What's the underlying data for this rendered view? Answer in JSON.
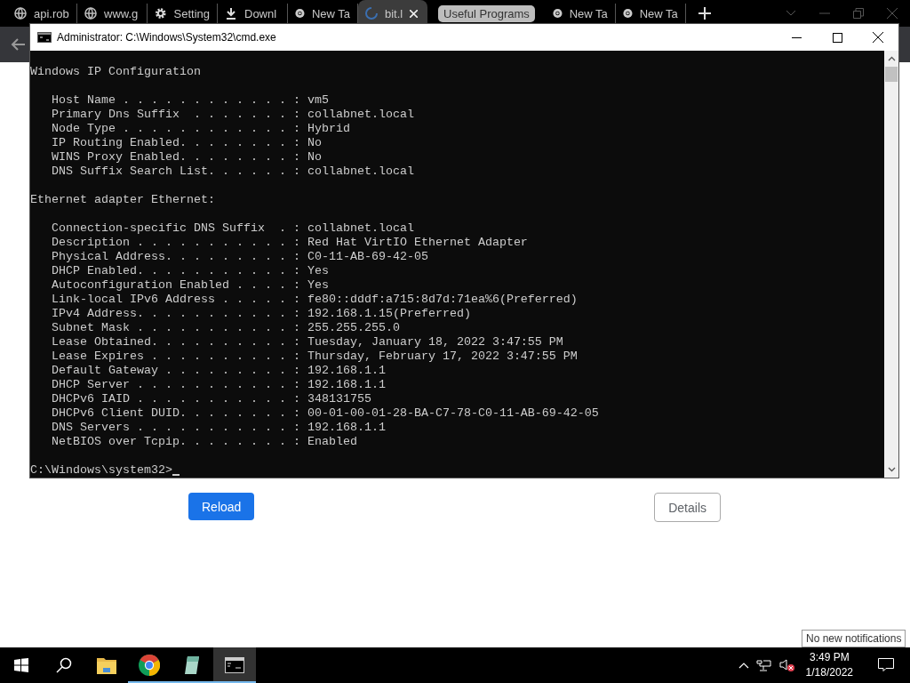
{
  "browser": {
    "tabs": [
      {
        "title": "api.rob",
        "kind": "globe",
        "selected": false
      },
      {
        "title": "www.g",
        "kind": "globe",
        "selected": false
      },
      {
        "title": "Setting",
        "kind": "gear",
        "selected": false
      },
      {
        "title": "Downl",
        "kind": "download",
        "selected": false
      },
      {
        "title": "New Ta",
        "kind": "chrome",
        "selected": false
      },
      {
        "title": "bit.l",
        "kind": "loading",
        "selected": true
      },
      {
        "title": "Useful Programs",
        "kind": "group",
        "selected": false
      },
      {
        "title": "New Ta",
        "kind": "chrome",
        "selected": false
      },
      {
        "title": "New Ta",
        "kind": "chrome",
        "selected": false
      }
    ]
  },
  "page": {
    "buttons": [
      {
        "label": "Reload",
        "kind": "primary"
      },
      {
        "label": "Details",
        "kind": "secondary"
      }
    ]
  },
  "console_window": {
    "title": "Administrator: C:\\Windows\\System32\\cmd.exe",
    "blocks": [
      [
        "Windows IP Configuration"
      ],
      [
        "   Host Name . . . . . . . . . . . . : vm5",
        "   Primary Dns Suffix  . . . . . . . : collabnet.local",
        "   Node Type . . . . . . . . . . . . : Hybrid",
        "   IP Routing Enabled. . . . . . . . : No",
        "   WINS Proxy Enabled. . . . . . . . : No",
        "   DNS Suffix Search List. . . . . . : collabnet.local"
      ],
      [
        "Ethernet adapter Ethernet:"
      ],
      [
        "   Connection-specific DNS Suffix  . : collabnet.local",
        "   Description . . . . . . . . . . . : Red Hat VirtIO Ethernet Adapter",
        "   Physical Address. . . . . . . . . : C0-11-AB-69-42-05",
        "   DHCP Enabled. . . . . . . . . . . : Yes",
        "   Autoconfiguration Enabled . . . . : Yes",
        "   Link-local IPv6 Address . . . . . : fe80::dddf:a715:8d7d:71ea%6(Preferred)",
        "   IPv4 Address. . . . . . . . . . . : 192.168.1.15(Preferred)",
        "   Subnet Mask . . . . . . . . . . . : 255.255.255.0",
        "   Lease Obtained. . . . . . . . . . : Tuesday, January 18, 2022 3:47:55 PM",
        "   Lease Expires . . . . . . . . . . : Thursday, February 17, 2022 3:47:55 PM",
        "   Default Gateway . . . . . . . . . : 192.168.1.1",
        "   DHCP Server . . . . . . . . . . . : 192.168.1.1",
        "   DHCPv6 IAID . . . . . . . . . . . : 348131755",
        "   DHCPv6 Client DUID. . . . . . . . : 00-01-00-01-28-BA-C7-78-C0-11-AB-69-42-05",
        "   DNS Servers . . . . . . . . . . . : 192.168.1.1",
        "   NetBIOS over Tcpip. . . . . . . . : Enabled"
      ]
    ],
    "prompt": "C:\\Windows\\system32>"
  },
  "taskbar": {
    "apps": [
      {
        "kind": "folder",
        "selected": false,
        "running": false
      },
      {
        "kind": "chrome",
        "selected": false,
        "running": true
      },
      {
        "kind": "notepad",
        "selected": false,
        "running": true
      },
      {
        "kind": "terminal",
        "selected": true,
        "running": true
      }
    ],
    "time": "3:49 PM",
    "date": "1/18/2022",
    "tooltip": "No new notifications"
  }
}
